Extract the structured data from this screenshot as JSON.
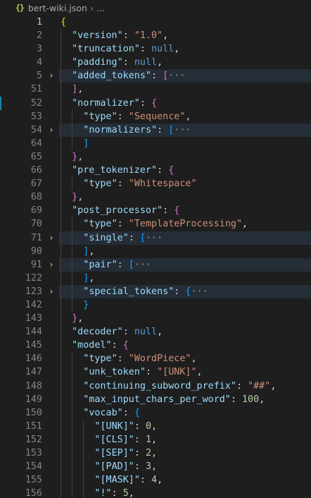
{
  "breadcrumb": {
    "icon_glyph": "{}",
    "file_name": "bert-wiki.json",
    "separator": "›",
    "ellipsis": "..."
  },
  "colors": {
    "background": "#1e1e1e",
    "key": "#9cdcfe",
    "string": "#ce9178",
    "number": "#b5cea8",
    "keyword": "#569cd6",
    "bracket_level1": "#ffd700",
    "bracket_level2": "#da70d6",
    "bracket_level3": "#179fff",
    "folded_line_highlight": "#252d37",
    "modified_gutter": "#1b81a8"
  },
  "lines": [
    {
      "num": "1",
      "active": true,
      "indent": 0,
      "tokens": [
        {
          "t": "{",
          "c": "b1"
        }
      ]
    },
    {
      "num": "2",
      "indent": 1,
      "tokens": [
        {
          "t": "\"version\"",
          "c": "k"
        },
        {
          "t": ": ",
          "c": "p"
        },
        {
          "t": "\"1.0\"",
          "c": "s"
        },
        {
          "t": ",",
          "c": "p"
        }
      ]
    },
    {
      "num": "3",
      "indent": 1,
      "tokens": [
        {
          "t": "\"truncation\"",
          "c": "k"
        },
        {
          "t": ": ",
          "c": "p"
        },
        {
          "t": "null",
          "c": "kw"
        },
        {
          "t": ",",
          "c": "p"
        }
      ]
    },
    {
      "num": "4",
      "indent": 1,
      "tokens": [
        {
          "t": "\"padding\"",
          "c": "k"
        },
        {
          "t": ": ",
          "c": "p"
        },
        {
          "t": "null",
          "c": "kw"
        },
        {
          "t": ",",
          "c": "p"
        }
      ]
    },
    {
      "num": "5",
      "indent": 1,
      "fold": "›",
      "folded": true,
      "tokens": [
        {
          "t": "\"added_tokens\"",
          "c": "k"
        },
        {
          "t": ": ",
          "c": "p"
        },
        {
          "t": "[",
          "c": "b2"
        },
        {
          "t": "···",
          "c": "ell"
        }
      ]
    },
    {
      "num": "51",
      "indent": 1,
      "tokens": [
        {
          "t": "]",
          "c": "b2"
        },
        {
          "t": ",",
          "c": "p"
        }
      ]
    },
    {
      "num": "52",
      "indent": 1,
      "modified": true,
      "tokens": [
        {
          "t": "\"normalizer\"",
          "c": "k"
        },
        {
          "t": ": ",
          "c": "p"
        },
        {
          "t": "{",
          "c": "b2"
        }
      ]
    },
    {
      "num": "53",
      "indent": 2,
      "tokens": [
        {
          "t": "\"type\"",
          "c": "k"
        },
        {
          "t": ": ",
          "c": "p"
        },
        {
          "t": "\"Sequence\"",
          "c": "s"
        },
        {
          "t": ",",
          "c": "p"
        }
      ]
    },
    {
      "num": "54",
      "indent": 2,
      "fold": "›",
      "folded": true,
      "tokens": [
        {
          "t": "\"normalizers\"",
          "c": "k"
        },
        {
          "t": ": ",
          "c": "p"
        },
        {
          "t": "[",
          "c": "b3"
        },
        {
          "t": "···",
          "c": "ell"
        }
      ]
    },
    {
      "num": "64",
      "indent": 2,
      "tokens": [
        {
          "t": "]",
          "c": "b3"
        }
      ]
    },
    {
      "num": "65",
      "indent": 1,
      "tokens": [
        {
          "t": "}",
          "c": "b2"
        },
        {
          "t": ",",
          "c": "p"
        }
      ]
    },
    {
      "num": "66",
      "indent": 1,
      "tokens": [
        {
          "t": "\"pre_tokenizer\"",
          "c": "k"
        },
        {
          "t": ": ",
          "c": "p"
        },
        {
          "t": "{",
          "c": "b2"
        }
      ]
    },
    {
      "num": "67",
      "indent": 2,
      "tokens": [
        {
          "t": "\"type\"",
          "c": "k"
        },
        {
          "t": ": ",
          "c": "p"
        },
        {
          "t": "\"Whitespace\"",
          "c": "s"
        }
      ]
    },
    {
      "num": "68",
      "indent": 1,
      "tokens": [
        {
          "t": "}",
          "c": "b2"
        },
        {
          "t": ",",
          "c": "p"
        }
      ]
    },
    {
      "num": "69",
      "indent": 1,
      "tokens": [
        {
          "t": "\"post_processor\"",
          "c": "k"
        },
        {
          "t": ": ",
          "c": "p"
        },
        {
          "t": "{",
          "c": "b2"
        }
      ]
    },
    {
      "num": "70",
      "indent": 2,
      "tokens": [
        {
          "t": "\"type\"",
          "c": "k"
        },
        {
          "t": ": ",
          "c": "p"
        },
        {
          "t": "\"TemplateProcessing\"",
          "c": "s"
        },
        {
          "t": ",",
          "c": "p"
        }
      ]
    },
    {
      "num": "71",
      "indent": 2,
      "fold": "›",
      "folded": true,
      "tokens": [
        {
          "t": "\"single\"",
          "c": "k"
        },
        {
          "t": ": ",
          "c": "p"
        },
        {
          "t": "[",
          "c": "b3"
        },
        {
          "t": "···",
          "c": "ell"
        }
      ]
    },
    {
      "num": "90",
      "indent": 2,
      "tokens": [
        {
          "t": "]",
          "c": "b3"
        },
        {
          "t": ",",
          "c": "p"
        }
      ]
    },
    {
      "num": "91",
      "indent": 2,
      "fold": "›",
      "folded": true,
      "tokens": [
        {
          "t": "\"pair\"",
          "c": "k"
        },
        {
          "t": ": ",
          "c": "p"
        },
        {
          "t": "[",
          "c": "b3"
        },
        {
          "t": "···",
          "c": "ell"
        }
      ]
    },
    {
      "num": "122",
      "indent": 2,
      "tokens": [
        {
          "t": "]",
          "c": "b3"
        },
        {
          "t": ",",
          "c": "p"
        }
      ]
    },
    {
      "num": "123",
      "indent": 2,
      "fold": "›",
      "folded": true,
      "tokens": [
        {
          "t": "\"special_tokens\"",
          "c": "k"
        },
        {
          "t": ": ",
          "c": "p"
        },
        {
          "t": "{",
          "c": "b3"
        },
        {
          "t": "···",
          "c": "ell"
        }
      ]
    },
    {
      "num": "142",
      "indent": 2,
      "tokens": [
        {
          "t": "}",
          "c": "b3"
        }
      ]
    },
    {
      "num": "143",
      "indent": 1,
      "tokens": [
        {
          "t": "}",
          "c": "b2"
        },
        {
          "t": ",",
          "c": "p"
        }
      ]
    },
    {
      "num": "144",
      "indent": 1,
      "tokens": [
        {
          "t": "\"decoder\"",
          "c": "k"
        },
        {
          "t": ": ",
          "c": "p"
        },
        {
          "t": "null",
          "c": "kw"
        },
        {
          "t": ",",
          "c": "p"
        }
      ]
    },
    {
      "num": "145",
      "indent": 1,
      "tokens": [
        {
          "t": "\"model\"",
          "c": "k"
        },
        {
          "t": ": ",
          "c": "p"
        },
        {
          "t": "{",
          "c": "b2"
        }
      ]
    },
    {
      "num": "146",
      "indent": 2,
      "tokens": [
        {
          "t": "\"type\"",
          "c": "k"
        },
        {
          "t": ": ",
          "c": "p"
        },
        {
          "t": "\"WordPiece\"",
          "c": "s"
        },
        {
          "t": ",",
          "c": "p"
        }
      ]
    },
    {
      "num": "147",
      "indent": 2,
      "tokens": [
        {
          "t": "\"unk_token\"",
          "c": "k"
        },
        {
          "t": ": ",
          "c": "p"
        },
        {
          "t": "\"[UNK]\"",
          "c": "s"
        },
        {
          "t": ",",
          "c": "p"
        }
      ]
    },
    {
      "num": "148",
      "indent": 2,
      "tokens": [
        {
          "t": "\"continuing_subword_prefix\"",
          "c": "k"
        },
        {
          "t": ": ",
          "c": "p"
        },
        {
          "t": "\"##\"",
          "c": "s"
        },
        {
          "t": ",",
          "c": "p"
        }
      ]
    },
    {
      "num": "149",
      "indent": 2,
      "tokens": [
        {
          "t": "\"max_input_chars_per_word\"",
          "c": "k"
        },
        {
          "t": ": ",
          "c": "p"
        },
        {
          "t": "100",
          "c": "n"
        },
        {
          "t": ",",
          "c": "p"
        }
      ]
    },
    {
      "num": "150",
      "indent": 2,
      "tokens": [
        {
          "t": "\"vocab\"",
          "c": "k"
        },
        {
          "t": ": ",
          "c": "p"
        },
        {
          "t": "{",
          "c": "b3"
        }
      ]
    },
    {
      "num": "151",
      "indent": 3,
      "tokens": [
        {
          "t": "\"[UNK]\"",
          "c": "k"
        },
        {
          "t": ": ",
          "c": "p"
        },
        {
          "t": "0",
          "c": "n"
        },
        {
          "t": ",",
          "c": "p"
        }
      ]
    },
    {
      "num": "152",
      "indent": 3,
      "tokens": [
        {
          "t": "\"[CLS]\"",
          "c": "k"
        },
        {
          "t": ": ",
          "c": "p"
        },
        {
          "t": "1",
          "c": "n"
        },
        {
          "t": ",",
          "c": "p"
        }
      ]
    },
    {
      "num": "153",
      "indent": 3,
      "tokens": [
        {
          "t": "\"[SEP]\"",
          "c": "k"
        },
        {
          "t": ": ",
          "c": "p"
        },
        {
          "t": "2",
          "c": "n"
        },
        {
          "t": ",",
          "c": "p"
        }
      ]
    },
    {
      "num": "154",
      "indent": 3,
      "tokens": [
        {
          "t": "\"[PAD]\"",
          "c": "k"
        },
        {
          "t": ": ",
          "c": "p"
        },
        {
          "t": "3",
          "c": "n"
        },
        {
          "t": ",",
          "c": "p"
        }
      ]
    },
    {
      "num": "155",
      "indent": 3,
      "tokens": [
        {
          "t": "\"[MASK]\"",
          "c": "k"
        },
        {
          "t": ": ",
          "c": "p"
        },
        {
          "t": "4",
          "c": "n"
        },
        {
          "t": ",",
          "c": "p"
        }
      ]
    },
    {
      "num": "156",
      "indent": 3,
      "tokens": [
        {
          "t": "\"!\"",
          "c": "k"
        },
        {
          "t": ": ",
          "c": "p"
        },
        {
          "t": "5",
          "c": "n"
        },
        {
          "t": ",",
          "c": "p"
        }
      ]
    }
  ]
}
